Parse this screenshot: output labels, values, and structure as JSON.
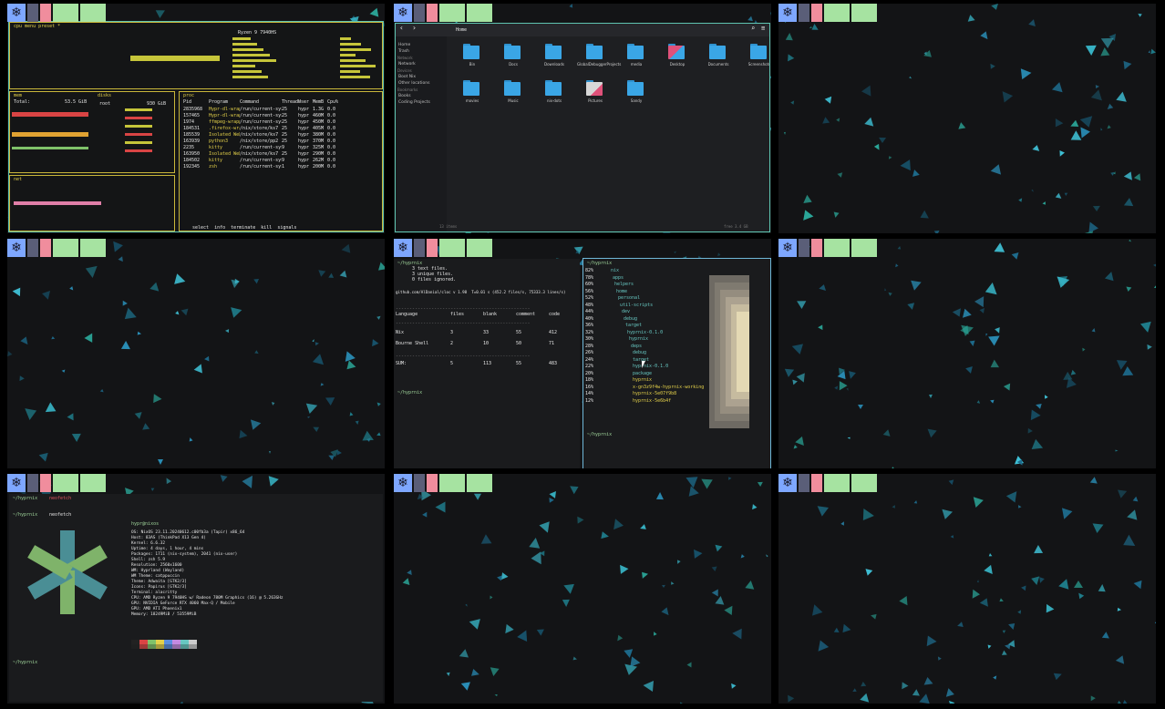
{
  "topbar": {
    "icon": "nix-snowflake-icon"
  },
  "colors": {
    "accent_active": "#5ec4b0",
    "accent_active_blue": "#6fb7d8",
    "bar_blue": "#7ea7ff",
    "bar_pink": "#f08d9d",
    "bar_green": "#a6e3a1",
    "bar_gray": "#5a5e78"
  },
  "btop": {
    "title": "cpu menu preset *",
    "cpu_model": "Ryzen 9 7940HS",
    "mem_label": "mem",
    "disks_label": "disks",
    "mem_total_label": "Total:",
    "mem_total": "53.5 GiB",
    "root_label": "root",
    "root_size": "930 GiB",
    "net_label": "net",
    "proc_label": "proc",
    "proc_header": [
      "Pid",
      "Program",
      "Command",
      "Threads",
      "User",
      "MemB",
      "Cpu%"
    ],
    "proc_rows": [
      [
        "2835968",
        "Hypr-dl-wrappe",
        "/run/current-sys",
        "25",
        "hypr",
        "1.3G",
        "0.0"
      ],
      [
        "157465",
        "Hypr-dl-wrappe",
        "/run/current-sys",
        "25",
        "hypr",
        "460M",
        "0.0"
      ],
      [
        "1974",
        "ffmpeg-wrapper",
        "/run/current-sys",
        "25",
        "hypr",
        "450M",
        "0.0"
      ],
      [
        "184531",
        ".firefox-wrappe",
        "/nix/store/ks7",
        "25",
        "hypr",
        "405M",
        "0.0"
      ],
      [
        "185539",
        "Isolated Web Co",
        "/nix/store/ks7",
        "25",
        "hypr",
        "380M",
        "0.0"
      ],
      [
        "163939",
        "python3",
        "/nix/store/pp2",
        "25",
        "hypr",
        "370M",
        "0.0"
      ],
      [
        "2235",
        "kitty",
        "/run/current-sys",
        "9",
        "hypr",
        "325M",
        "0.0"
      ],
      [
        "163950",
        "Isolated Web Co",
        "/nix/store/ks7",
        "25",
        "hypr",
        "290M",
        "0.0"
      ],
      [
        "184502",
        "kitty",
        "/run/current-sys",
        "9",
        "hypr",
        "262M",
        "0.0"
      ],
      [
        "192345",
        "zsh",
        "/run/current-sys",
        "1",
        "hypr",
        "200M",
        "0.0"
      ]
    ],
    "footer": "select  info  terminate  kill  signals"
  },
  "files": {
    "title": "Home",
    "sidebar": [
      {
        "type": "item",
        "label": "Home"
      },
      {
        "type": "item",
        "label": "Trash"
      },
      {
        "type": "head",
        "label": "Network"
      },
      {
        "type": "item",
        "label": "Network"
      },
      {
        "type": "head",
        "label": "Devices"
      },
      {
        "type": "item",
        "label": "Boot Nix"
      },
      {
        "type": "item",
        "label": "Other locations"
      },
      {
        "type": "head",
        "label": "Bookmarks"
      },
      {
        "type": "item",
        "label": "Books"
      },
      {
        "type": "item",
        "label": "Coding Projects"
      }
    ],
    "folders": [
      "Bin",
      "Docs",
      "Downloads",
      "GlobalDebuggerProjects",
      "media",
      "Desktop",
      "Documents",
      "Screenshots",
      "movies",
      "Music",
      "nix-dots",
      "Pictures",
      "Sandy"
    ],
    "status_left": "13 items",
    "status_right": "free 3.4 GB"
  },
  "term_tokei": {
    "prompt1": "~/hyprnix",
    "lines": [
      "3 text files.",
      "3 unique files.",
      "0 files ignored."
    ],
    "summary_line": "github.com/AlDanial/cloc v 1.98  T=0.01 s (452.2 files/s, 75333.3 lines/s)",
    "header": [
      "Language",
      "files",
      "blank",
      "comment",
      "code"
    ],
    "rows": [
      [
        "Nix",
        "3",
        "33",
        "55",
        "412"
      ],
      [
        "Bourne Shell",
        "2",
        "10",
        "50",
        "71"
      ]
    ],
    "sum_row": [
      "SUM:",
      "5",
      "113",
      "55",
      "483"
    ],
    "prompt2": "~/hyprnix"
  },
  "term_tree": {
    "prompt": "~/hyprnix",
    "tree": [
      "nix",
      "apps",
      "helpers",
      "home",
      "personal",
      "util-scripts",
      "dev",
      "debug",
      "target",
      "hyprnix-0.1.0",
      "hyprnix",
      "deps",
      "debug",
      "target",
      "hyprnix-0.1.0",
      "package",
      "hyprnix",
      "x-gn3z9f4w-hyprnix-working",
      "hyprnix-5e07f9b8",
      "hyprnix-5e6b4f"
    ],
    "pcts": [
      "82%",
      "78%",
      "60%",
      "56%",
      "52%",
      "48%",
      "44%",
      "40%",
      "36%",
      "32%",
      "30%",
      "28%",
      "26%",
      "24%",
      "22%",
      "20%",
      "18%",
      "16%",
      "14%",
      "12%"
    ],
    "prompt_end": "~/hyprnix"
  },
  "term_fetch": {
    "prompt1": "~/hyprnix",
    "cmd1": "neofetch",
    "prompt2": "~/hyprnix",
    "cmd2": "neofetch",
    "user_host": "hypr@nixos",
    "info": [
      "OS: NixOS 23.11.20240612.c00fb3a (Tapir) x86_64",
      "Host: 83AS (ThinkPad X13 Gen 4)",
      "Kernel: 6.6.32",
      "Uptime: 4 days, 1 hour, 4 mins",
      "Packages: 1711 (nix-system), 2041 (nix-user)",
      "Shell: zsh 5.9",
      "Resolution: 2560x1600",
      "WM: Hyprland (Wayland)",
      "WM Theme: catppuccin",
      "Theme: Adwaita [GTK2/3]",
      "Icons: Papirus [GTK2/3]",
      "Terminal: alacritty",
      "CPU: AMD Ryzen 9 7940HS w/ Radeon 780M Graphics (16) @ 5.263GHz",
      "GPU: NVIDIA GeForce RTX 4060 Max-Q / Mobile",
      "GPU: AMD ATI Phoenix1",
      "Memory: 18249MiB / 53559MiB"
    ],
    "prompt3": "~/hyprnix"
  }
}
